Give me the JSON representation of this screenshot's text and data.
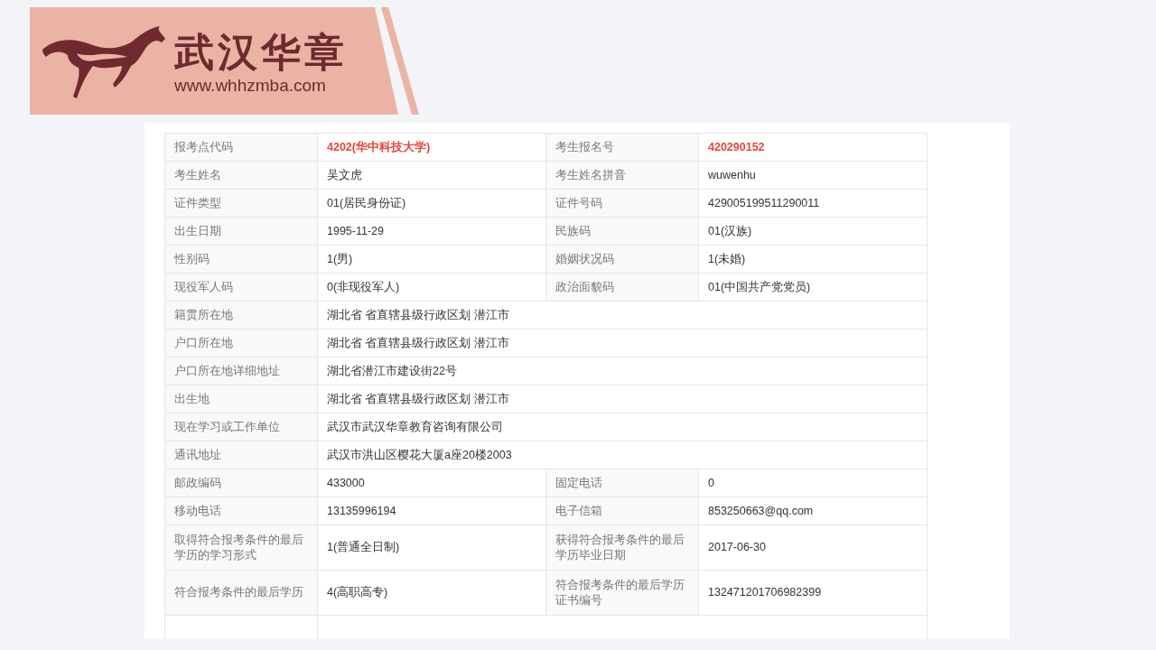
{
  "logo": {
    "name": "武汉华章",
    "url": "www.whhzmba.com"
  },
  "rows": [
    {
      "kind": "pair",
      "fields": [
        {
          "label": "报考点代码",
          "value": "4202(华中科技大学)",
          "highlighted": true
        },
        {
          "label": "考生报名号",
          "value": "420290152",
          "highlighted": true
        }
      ]
    },
    {
      "kind": "pair",
      "fields": [
        {
          "label": "考生姓名",
          "value": "吴文虎",
          "highlighted": false
        },
        {
          "label": "考生姓名拼音",
          "value": "wuwenhu",
          "highlighted": false
        }
      ]
    },
    {
      "kind": "pair",
      "fields": [
        {
          "label": "证件类型",
          "value": "01(居民身份证)",
          "highlighted": false
        },
        {
          "label": "证件号码",
          "value": "429005199511290011",
          "highlighted": false
        }
      ]
    },
    {
      "kind": "pair",
      "fields": [
        {
          "label": "出生日期",
          "value": "1995-11-29",
          "highlighted": false
        },
        {
          "label": "民族码",
          "value": "01(汉族)",
          "highlighted": false
        }
      ]
    },
    {
      "kind": "pair",
      "fields": [
        {
          "label": "性别码",
          "value": "1(男)",
          "highlighted": false
        },
        {
          "label": "婚姻状况码",
          "value": "1(未婚)",
          "highlighted": false
        }
      ]
    },
    {
      "kind": "pair",
      "fields": [
        {
          "label": "现役军人码",
          "value": "0(非现役军人)",
          "highlighted": false
        },
        {
          "label": "政治面貌码",
          "value": "01(中国共产党党员)",
          "highlighted": false
        }
      ]
    },
    {
      "kind": "wide",
      "fields": [
        {
          "label": "籍贯所在地",
          "value": "湖北省 省直辖县级行政区划 潜江市",
          "highlighted": false
        }
      ]
    },
    {
      "kind": "wide",
      "fields": [
        {
          "label": "户口所在地",
          "value": "湖北省 省直辖县级行政区划 潜江市",
          "highlighted": false
        }
      ]
    },
    {
      "kind": "wide",
      "fields": [
        {
          "label": "户口所在地详细地址",
          "value": "湖北省潜江市建设街22号",
          "highlighted": false
        }
      ]
    },
    {
      "kind": "wide",
      "fields": [
        {
          "label": "出生地",
          "value": "湖北省 省直辖县级行政区划 潜江市",
          "highlighted": false
        }
      ]
    },
    {
      "kind": "wide",
      "fields": [
        {
          "label": "现在学习或工作单位",
          "value": "武汉市武汉华章教育咨询有限公司",
          "highlighted": false
        }
      ]
    },
    {
      "kind": "wide",
      "fields": [
        {
          "label": "通讯地址",
          "value": "武汉市洪山区樱花大厦a座20楼2003",
          "highlighted": false
        }
      ]
    },
    {
      "kind": "pair",
      "fields": [
        {
          "label": "邮政编码",
          "value": "433000",
          "highlighted": false
        },
        {
          "label": "固定电话",
          "value": "0",
          "highlighted": false
        }
      ]
    },
    {
      "kind": "pair",
      "fields": [
        {
          "label": "移动电话",
          "value": "13135996194",
          "highlighted": false
        },
        {
          "label": "电子信箱",
          "value": "853250663@qq.com",
          "highlighted": false
        }
      ]
    },
    {
      "kind": "tall",
      "fields": [
        {
          "label": "取得符合报考条件的最后学历的学习形式",
          "value": "1(普通全日制)",
          "highlighted": false
        },
        {
          "label": "获得符合报考条件的最后学历毕业日期",
          "value": "2017-06-30",
          "highlighted": false
        }
      ]
    },
    {
      "kind": "tall",
      "fields": [
        {
          "label": "符合报考条件的最后学历",
          "value": "4(高职高专)",
          "highlighted": false
        },
        {
          "label": "符合报考条件的最后学历证书编号",
          "value": "132471201706982399",
          "highlighted": false
        }
      ]
    }
  ]
}
